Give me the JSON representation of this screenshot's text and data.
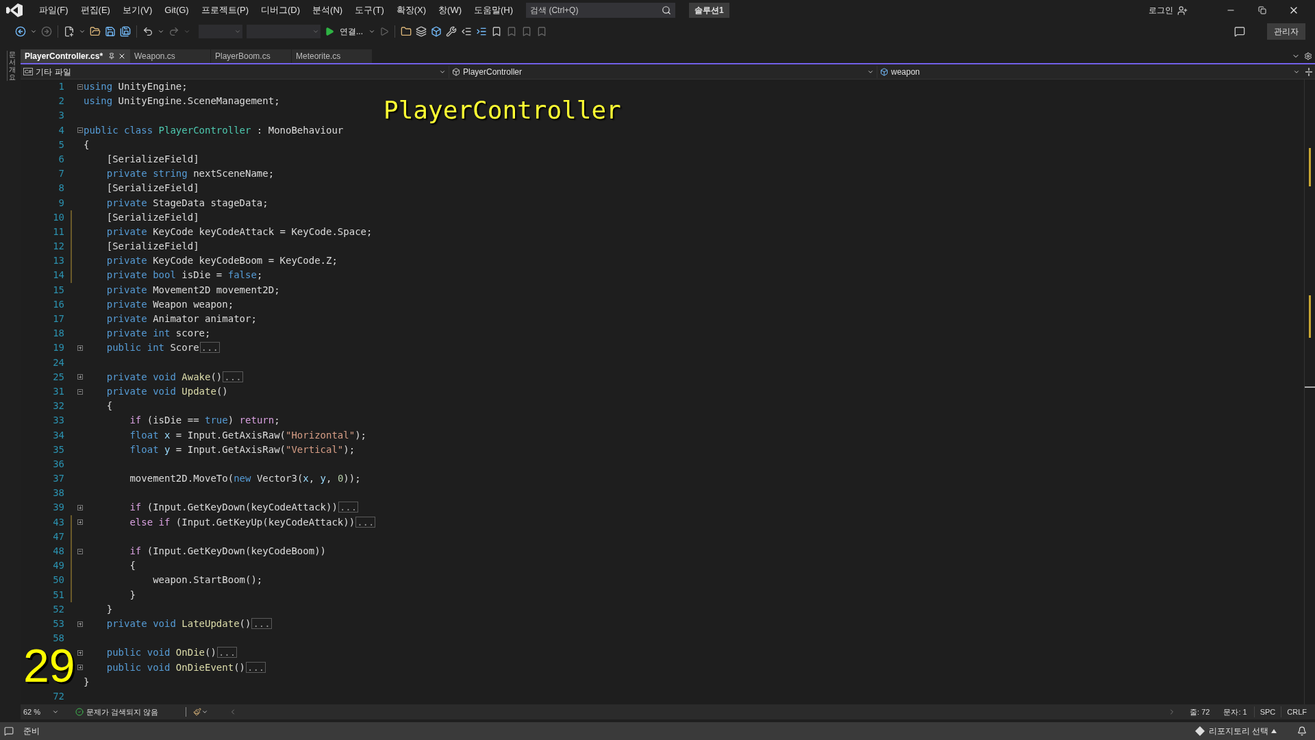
{
  "menu": [
    "파일(F)",
    "편집(E)",
    "보기(V)",
    "Git(G)",
    "프로젝트(P)",
    "디버그(D)",
    "분석(N)",
    "도구(T)",
    "확장(X)",
    "창(W)",
    "도움말(H)"
  ],
  "search": {
    "placeholder": "검색 (Ctrl+Q)"
  },
  "solution": "솔루션1",
  "login": "로그인",
  "toolbar": {
    "run_label": "연결..."
  },
  "admin": "관리자",
  "side_tab": "문서 개요",
  "tabs": [
    {
      "label": "PlayerController.cs*",
      "selected": true
    },
    {
      "label": "Weapon.cs",
      "selected": false
    },
    {
      "label": "PlayerBoom.cs",
      "selected": false
    },
    {
      "label": "Meteorite.cs",
      "selected": false
    }
  ],
  "nav": {
    "project_badge": "C#",
    "project": "기타 파일",
    "type": "PlayerController",
    "member": "weapon"
  },
  "code_lines": [
    {
      "n": "1",
      "folded": false,
      "changed": false,
      "tokens": [
        {
          "kind": "keyword",
          "text": "using"
        },
        {
          "kind": "plain",
          "text": " UnityEngine;"
        }
      ]
    },
    {
      "n": "2",
      "changed": false,
      "tokens": [
        {
          "kind": "keyword",
          "text": "using"
        },
        {
          "kind": "plain",
          "text": " UnityEngine.SceneManagement;"
        }
      ]
    },
    {
      "n": "3",
      "changed": false
    },
    {
      "n": "4",
      "folded": false,
      "changed": false,
      "tokens": [
        {
          "kind": "keyword",
          "text": "public class "
        },
        {
          "kind": "type",
          "text": "PlayerController"
        },
        {
          "kind": "plain",
          "text": " : MonoBehaviour"
        }
      ]
    },
    {
      "n": "5",
      "changed": false,
      "tokens": [
        {
          "kind": "plain",
          "text": "{"
        }
      ]
    },
    {
      "n": "6",
      "changed": false,
      "tokens": [
        {
          "kind": "plain",
          "text": "    [SerializeField]"
        }
      ]
    },
    {
      "n": "7",
      "changed": false,
      "tokens": [
        {
          "kind": "keyword",
          "text": "    private string"
        },
        {
          "kind": "plain",
          "text": " nextSceneName;"
        }
      ]
    },
    {
      "n": "8",
      "changed": false,
      "tokens": [
        {
          "kind": "plain",
          "text": "    [SerializeField]"
        }
      ]
    },
    {
      "n": "9",
      "changed": false,
      "tokens": [
        {
          "kind": "keyword",
          "text": "    private"
        },
        {
          "kind": "plain",
          "text": " StageData stageData;"
        }
      ]
    },
    {
      "n": "10",
      "changed": true,
      "tokens": [
        {
          "kind": "plain",
          "text": "    [SerializeField]"
        }
      ]
    },
    {
      "n": "11",
      "changed": true,
      "tokens": [
        {
          "kind": "keyword",
          "text": "    private"
        },
        {
          "kind": "plain",
          "text": " KeyCode keyCodeAttack = KeyCode.Space;"
        }
      ]
    },
    {
      "n": "12",
      "changed": true,
      "tokens": [
        {
          "kind": "plain",
          "text": "    [SerializeField]"
        }
      ]
    },
    {
      "n": "13",
      "changed": true,
      "tokens": [
        {
          "kind": "keyword",
          "text": "    private"
        },
        {
          "kind": "plain",
          "text": " KeyCode keyCodeBoom = KeyCode.Z;"
        }
      ]
    },
    {
      "n": "14",
      "changed": true,
      "tokens": [
        {
          "kind": "keyword",
          "text": "    private bool"
        },
        {
          "kind": "plain",
          "text": " isDie = "
        },
        {
          "kind": "keyword",
          "text": "false"
        },
        {
          "kind": "plain",
          "text": ";"
        }
      ]
    },
    {
      "n": "15",
      "changed": false,
      "tokens": [
        {
          "kind": "keyword",
          "text": "    private"
        },
        {
          "kind": "plain",
          "text": " Movement2D movement2D;"
        }
      ]
    },
    {
      "n": "16",
      "changed": false,
      "tokens": [
        {
          "kind": "keyword",
          "text": "    private"
        },
        {
          "kind": "plain",
          "text": " Weapon weapon;"
        }
      ]
    },
    {
      "n": "17",
      "changed": false,
      "tokens": [
        {
          "kind": "keyword",
          "text": "    private"
        },
        {
          "kind": "plain",
          "text": " Animator animator;"
        }
      ]
    },
    {
      "n": "18",
      "changed": false,
      "tokens": [
        {
          "kind": "keyword",
          "text": "    private int"
        },
        {
          "kind": "plain",
          "text": " score;"
        }
      ]
    },
    {
      "n": "19",
      "folded": true,
      "changed": false,
      "tokens": [
        {
          "kind": "keyword",
          "text": "    public int"
        },
        {
          "kind": "plain",
          "text": " Score"
        },
        {
          "kind": "collapsed",
          "text": "..."
        }
      ]
    },
    {
      "n": "24",
      "changed": false
    },
    {
      "n": "25",
      "folded": true,
      "changed": false,
      "tokens": [
        {
          "kind": "keyword",
          "text": "    private void"
        },
        {
          "kind": "method",
          "text": " Awake"
        },
        {
          "kind": "plain",
          "text": "()"
        },
        {
          "kind": "collapsed",
          "text": "..."
        }
      ]
    },
    {
      "n": "31",
      "folded": false,
      "changed": false,
      "tokens": [
        {
          "kind": "keyword",
          "text": "    private void"
        },
        {
          "kind": "method",
          "text": " Update"
        },
        {
          "kind": "plain",
          "text": "()"
        }
      ]
    },
    {
      "n": "32",
      "changed": false,
      "tokens": [
        {
          "kind": "plain",
          "text": "    {"
        }
      ]
    },
    {
      "n": "33",
      "changed": false,
      "tokens": [
        {
          "kind": "control",
          "text": "        if"
        },
        {
          "kind": "plain",
          "text": " (isDie == "
        },
        {
          "kind": "keyword",
          "text": "true"
        },
        {
          "kind": "plain",
          "text": ") "
        },
        {
          "kind": "control",
          "text": "return"
        },
        {
          "kind": "plain",
          "text": ";"
        }
      ]
    },
    {
      "n": "34",
      "changed": false,
      "tokens": [
        {
          "kind": "keyword",
          "text": "        float"
        },
        {
          "kind": "variable",
          "text": " x"
        },
        {
          "kind": "plain",
          "text": " = Input.GetAxisRaw("
        },
        {
          "kind": "string",
          "text": "\"Horizontal\""
        },
        {
          "kind": "plain",
          "text": ");"
        }
      ]
    },
    {
      "n": "35",
      "changed": false,
      "tokens": [
        {
          "kind": "keyword",
          "text": "        float"
        },
        {
          "kind": "variable",
          "text": " y"
        },
        {
          "kind": "plain",
          "text": " = Input.GetAxisRaw("
        },
        {
          "kind": "string",
          "text": "\"Vertical\""
        },
        {
          "kind": "plain",
          "text": ");"
        }
      ]
    },
    {
      "n": "36",
      "changed": false
    },
    {
      "n": "37",
      "changed": false,
      "tokens": [
        {
          "kind": "plain",
          "text": "        movement2D.MoveTo("
        },
        {
          "kind": "keyword",
          "text": "new"
        },
        {
          "kind": "plain",
          "text": " Vector3("
        },
        {
          "kind": "variable",
          "text": "x"
        },
        {
          "kind": "plain",
          "text": ", "
        },
        {
          "kind": "variable",
          "text": "y"
        },
        {
          "kind": "plain",
          "text": ", "
        },
        {
          "kind": "number",
          "text": "0"
        },
        {
          "kind": "plain",
          "text": "));"
        }
      ]
    },
    {
      "n": "38",
      "changed": false
    },
    {
      "n": "39",
      "folded": true,
      "changed": false,
      "tokens": [
        {
          "kind": "control",
          "text": "        if"
        },
        {
          "kind": "plain",
          "text": " (Input.GetKeyDown(keyCodeAttack))"
        },
        {
          "kind": "collapsed",
          "text": "..."
        }
      ]
    },
    {
      "n": "43",
      "folded": true,
      "changed": true,
      "tokens": [
        {
          "kind": "control",
          "text": "        else if"
        },
        {
          "kind": "plain",
          "text": " (Input.GetKeyUp(keyCodeAttack))"
        },
        {
          "kind": "collapsed",
          "text": "..."
        }
      ]
    },
    {
      "n": "47",
      "changed": true
    },
    {
      "n": "48",
      "folded": false,
      "changed": true,
      "tokens": [
        {
          "kind": "control",
          "text": "        if"
        },
        {
          "kind": "plain",
          "text": " (Input.GetKeyDown(keyCodeBoom))"
        }
      ]
    },
    {
      "n": "49",
      "changed": true,
      "tokens": [
        {
          "kind": "plain",
          "text": "        {"
        }
      ]
    },
    {
      "n": "50",
      "changed": true,
      "tokens": [
        {
          "kind": "plain",
          "text": "            weapon.StartBoom();"
        }
      ]
    },
    {
      "n": "51",
      "changed": true,
      "tokens": [
        {
          "kind": "plain",
          "text": "        }"
        }
      ]
    },
    {
      "n": "52",
      "changed": false,
      "tokens": [
        {
          "kind": "plain",
          "text": "    }"
        }
      ]
    },
    {
      "n": "53",
      "folded": true,
      "changed": false,
      "tokens": [
        {
          "kind": "keyword",
          "text": "    private void"
        },
        {
          "kind": "method",
          "text": " LateUpdate"
        },
        {
          "kind": "plain",
          "text": "()"
        },
        {
          "kind": "collapsed",
          "text": "..."
        }
      ]
    },
    {
      "n": "58",
      "changed": false
    },
    {
      "folded": true,
      "changed": false,
      "tokens": [
        {
          "kind": "keyword",
          "text": "    public void"
        },
        {
          "kind": "method",
          "text": " OnDie"
        },
        {
          "kind": "plain",
          "text": "()"
        },
        {
          "kind": "collapsed",
          "text": "..."
        }
      ]
    },
    {
      "folded": true,
      "changed": false,
      "tokens": [
        {
          "kind": "keyword",
          "text": "    public void"
        },
        {
          "kind": "method",
          "text": " OnDieEvent"
        },
        {
          "kind": "plain",
          "text": "()"
        },
        {
          "kind": "collapsed",
          "text": "..."
        }
      ]
    },
    {
      "changed": false,
      "tokens": [
        {
          "kind": "plain",
          "text": "}"
        }
      ]
    },
    {
      "n": "72",
      "changed": false
    }
  ],
  "overlay": {
    "title": "PlayerController",
    "number": "29"
  },
  "editor_status": {
    "zoom": "62 %",
    "issues": "문제가 검색되지 않음",
    "line": "줄: 72",
    "col": "문자: 1",
    "spaces": "SPC",
    "eol": "CRLF"
  },
  "status_bar": {
    "state": "준비",
    "repo": "리포지토리 선택"
  }
}
